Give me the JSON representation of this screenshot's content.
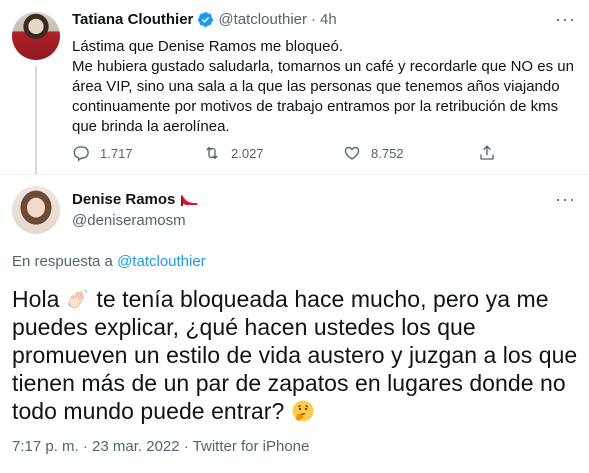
{
  "tweet1": {
    "author_name": "Tatiana Clouthier",
    "handle": "@tatclouthier",
    "separator": "·",
    "time": "4h",
    "lines": [
      "Lástima que Denise Ramos me bloqueó.",
      "Me hubiera gustado saludarla, tomarnos un café y recordarle que NO es un",
      "área VIP, sino una sala a la que las personas que tenemos años viajando",
      "continuamente por motivos de trabajo entramos por la retribución de kms",
      "que brinda la aerolínea."
    ],
    "replies": "1.717",
    "retweets": "2.027",
    "likes": "8.752"
  },
  "tweet2": {
    "author_name": "Denise Ramos",
    "handle": "@deniseramosm",
    "reply_prefix": "En respuesta a",
    "reply_handle": "@tatclouthier",
    "text_line1_a": "Hola",
    "text_line1_b": "te tenía bloqueada hace mucho, pero ya me",
    "text_lines": [
      "puedes explicar, ¿qué hacen ustedes los que",
      "promueven un estilo de vida austero y juzgan a los que",
      "tienen más de un par de zapatos en lugares donde no"
    ],
    "text_line5": "todo mundo puede entrar?",
    "timestamp": "7:17 p. m. · 23 mar. 2022 · Twitter for iPhone"
  },
  "icons": {
    "verified": "verified-badge-icon",
    "reply": "reply-icon",
    "retweet": "retweet-icon",
    "like": "heart-icon",
    "share": "share-icon",
    "more": "more-icon",
    "heel": "high-heel-emoji",
    "wave": "waving-hand-emoji",
    "thinking": "thinking-face-emoji"
  },
  "colors": {
    "link": "#1d9bf0",
    "verified": "#1d9bf0",
    "secondary": "#536471"
  }
}
